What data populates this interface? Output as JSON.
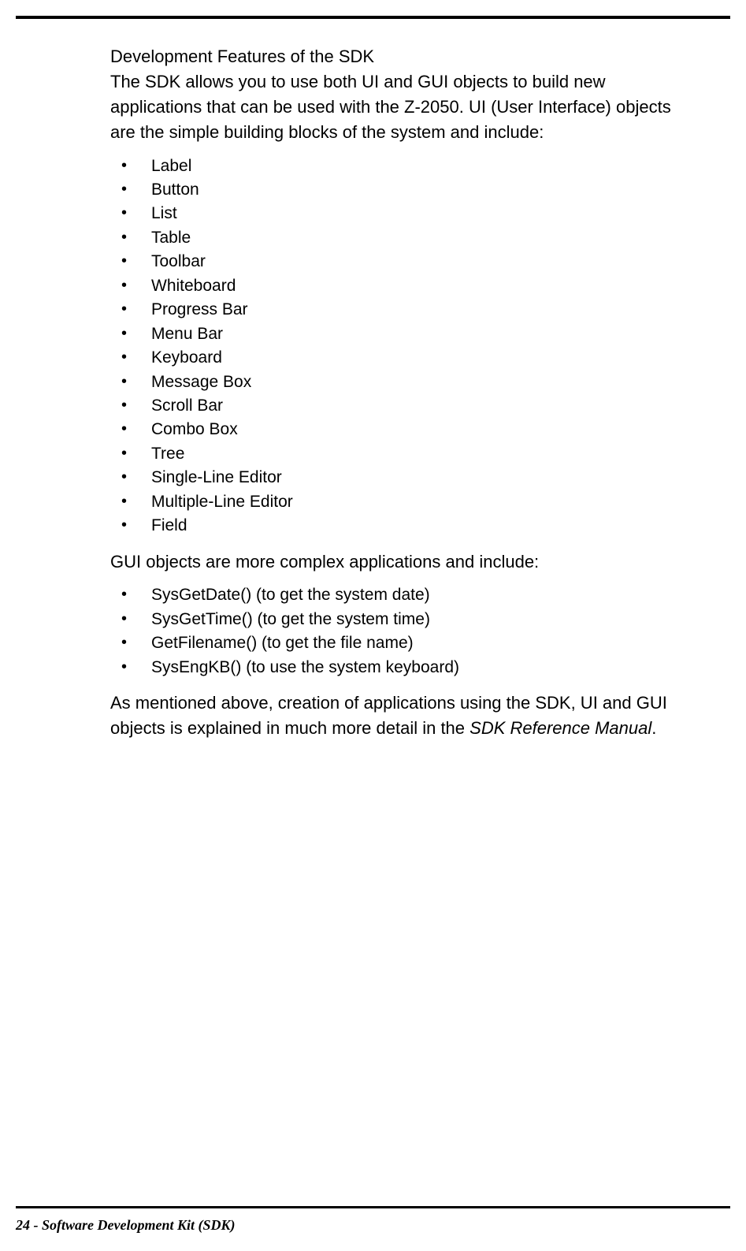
{
  "heading": "Development Features of the SDK",
  "intro": "The SDK allows you to use both UI and GUI objects to build new applications that can be used with the Z-2050. UI (User Interface) objects are the simple building blocks of the system and include:",
  "ui_objects": [
    "Label",
    "Button",
    "List",
    "Table",
    "Toolbar",
    "Whiteboard",
    "Progress Bar",
    "Menu Bar",
    "Keyboard",
    "Message Box",
    "Scroll Bar",
    "Combo Box",
    "Tree",
    "Single-Line Editor",
    "Multiple-Line Editor",
    "Field"
  ],
  "gui_intro": "GUI objects are more complex applications and include:",
  "gui_objects": [
    "SysGetDate() (to get the system date)",
    "SysGetTime() (to get the system time)",
    "GetFilename() (to get the file name)",
    "SysEngKB() (to use the system keyboard)"
  ],
  "closing_pre": "As mentioned above, creation of applications using the SDK, UI and GUI objects is explained in much more detail in the ",
  "closing_italic": "SDK Reference Manual",
  "closing_post": ".",
  "footer": "24  -  Software Development Kit (SDK)"
}
